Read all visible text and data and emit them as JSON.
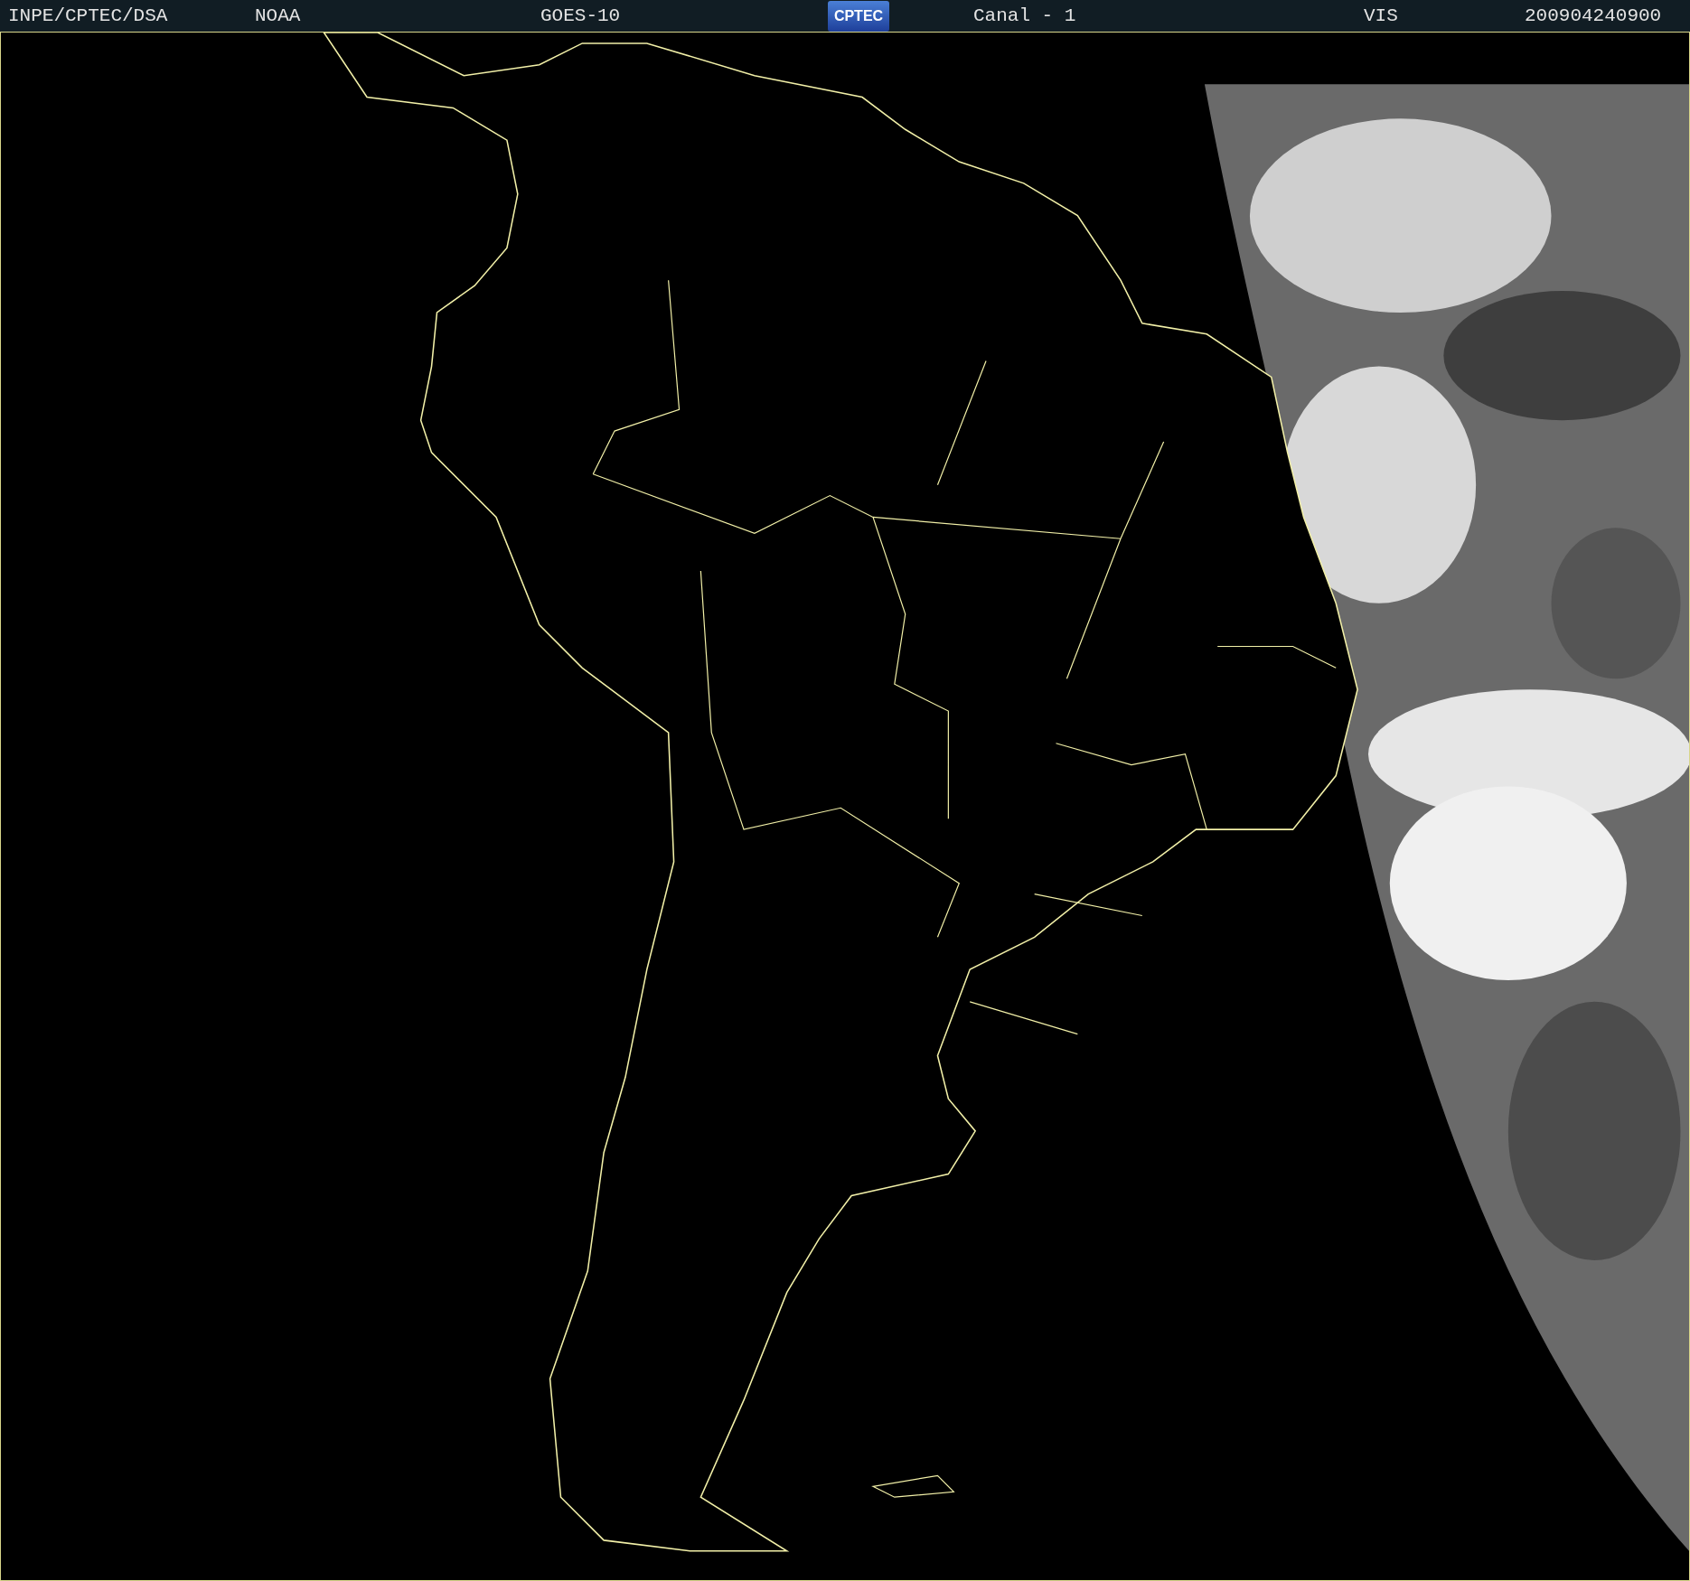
{
  "header": {
    "agency": "INPE/CPTEC/DSA",
    "source": "NOAA",
    "satellite": "GOES-10",
    "logo": "CPTEC",
    "channel": "Canal - 1",
    "band": "VIS",
    "timestamp": "200904240900"
  }
}
